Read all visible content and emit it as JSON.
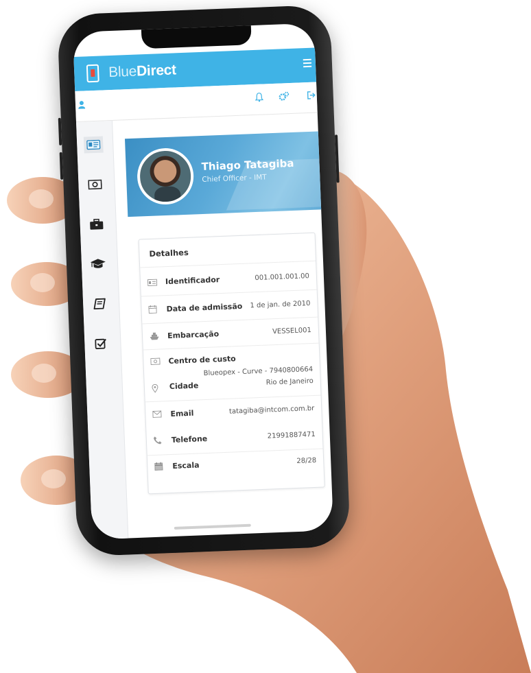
{
  "app": {
    "brand_part1": "Blue",
    "brand_part2": "Direct"
  },
  "toolbar": {
    "icons": [
      "user-icon",
      "bell-icon",
      "gears-icon",
      "logout-icon"
    ]
  },
  "sidebar": {
    "items": [
      {
        "icon": "id-card-icon",
        "active": true
      },
      {
        "icon": "money-icon",
        "active": false
      },
      {
        "icon": "briefcase-icon",
        "active": false
      },
      {
        "icon": "graduation-cap-icon",
        "active": false
      },
      {
        "icon": "book-icon",
        "active": false
      },
      {
        "icon": "checkbox-icon",
        "active": false
      }
    ]
  },
  "profile": {
    "name": "Thiago Tatagiba",
    "role": "Chief Officer - IMT"
  },
  "details": {
    "title": "Detalhes",
    "rows": [
      {
        "icon": "id-card-icon",
        "label": "Identificador",
        "value": "001.001.001.00"
      },
      {
        "icon": "calendar-icon",
        "label": "Data de admissão",
        "value": "1 de jan. de 2010"
      },
      {
        "icon": "ship-icon",
        "label": "Embarcação",
        "value": "VESSEL001"
      },
      {
        "icon": "money-icon",
        "label": "Centro de custo",
        "value": "Blueopex - Curve - 7940800664"
      },
      {
        "icon": "map-pin-icon",
        "label": "Cidade",
        "value": "Rio de Janeiro"
      },
      {
        "icon": "envelope-icon",
        "label": "Email",
        "value": "tatagiba@intcom.com.br"
      },
      {
        "icon": "phone-icon",
        "label": "Telefone",
        "value": "21991887471"
      },
      {
        "icon": "calendar-icon",
        "label": "Escala",
        "value": "28/28"
      }
    ]
  },
  "colors": {
    "header": "#3fb3e6",
    "accent": "#3fb3e6",
    "sidebar": "#f4f5f7"
  }
}
